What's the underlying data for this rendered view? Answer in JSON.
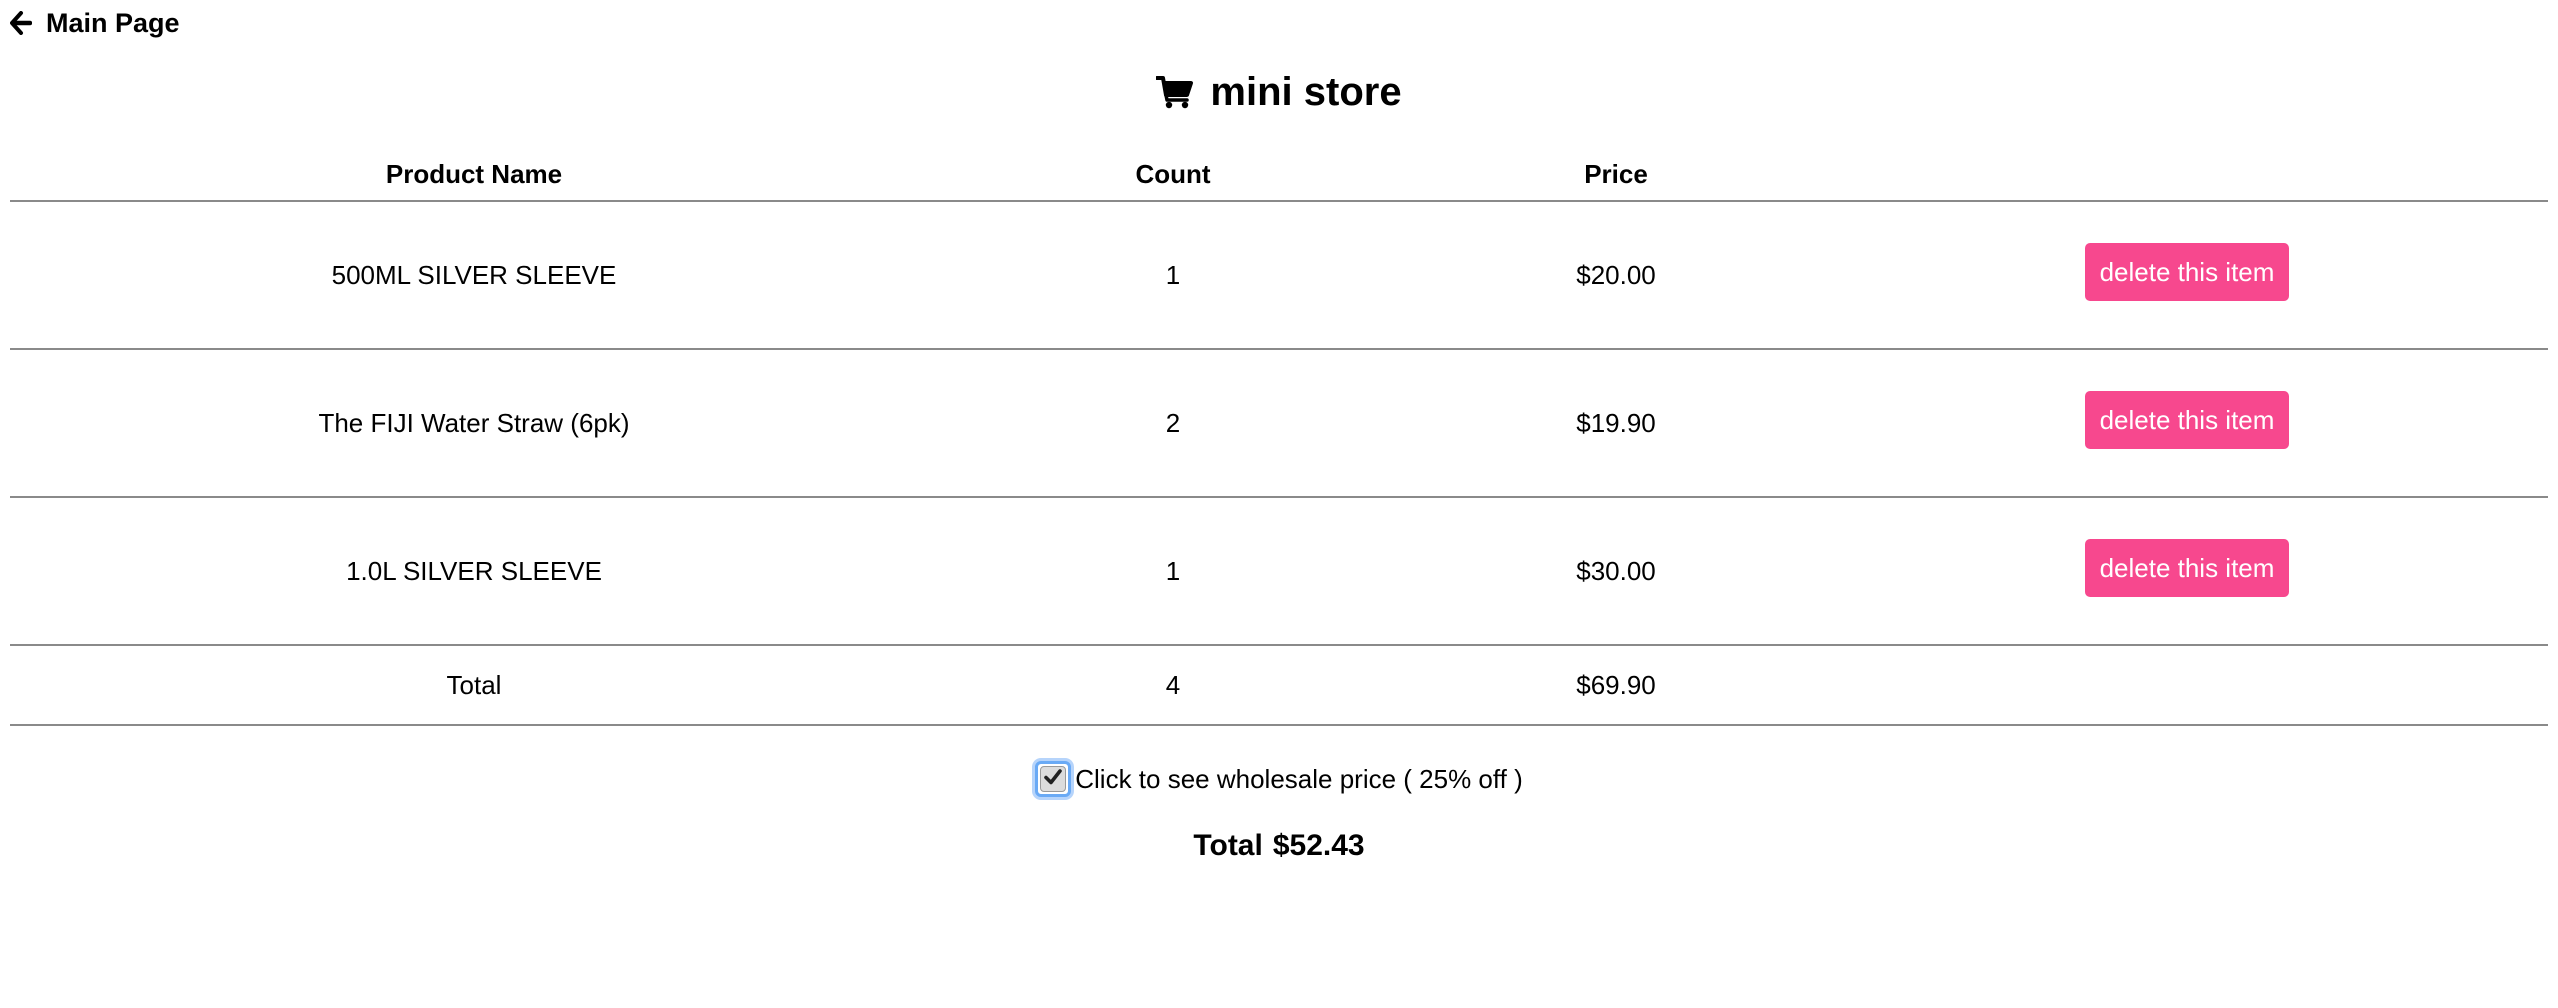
{
  "nav": {
    "back_label": "Main Page",
    "back_icon": "arrow-left-icon"
  },
  "header": {
    "title": "mini store",
    "icon": "shopping-cart-icon"
  },
  "table": {
    "columns": [
      "Product Name",
      "Count",
      "Price",
      ""
    ],
    "rows": [
      {
        "name": "500ML SILVER SLEEVE",
        "count": "1",
        "price": "$20.00",
        "action": "delete this item"
      },
      {
        "name": "The FIJI Water Straw (6pk)",
        "count": "2",
        "price": "$19.90",
        "action": "delete this item"
      },
      {
        "name": "1.0L SILVER SLEEVE",
        "count": "1",
        "price": "$30.00",
        "action": "delete this item"
      }
    ],
    "total": {
      "label": "Total",
      "count": "4",
      "price": "$69.90"
    }
  },
  "wholesale": {
    "checked": true,
    "label": "Click to see wholesale price ( 25% off )"
  },
  "grand_total": {
    "label": "Total",
    "value": "$52.43"
  },
  "colors": {
    "delete_button": "#f7488e",
    "checkbox_focus": "#6aaaf5",
    "rule": "#8a8a8a"
  }
}
